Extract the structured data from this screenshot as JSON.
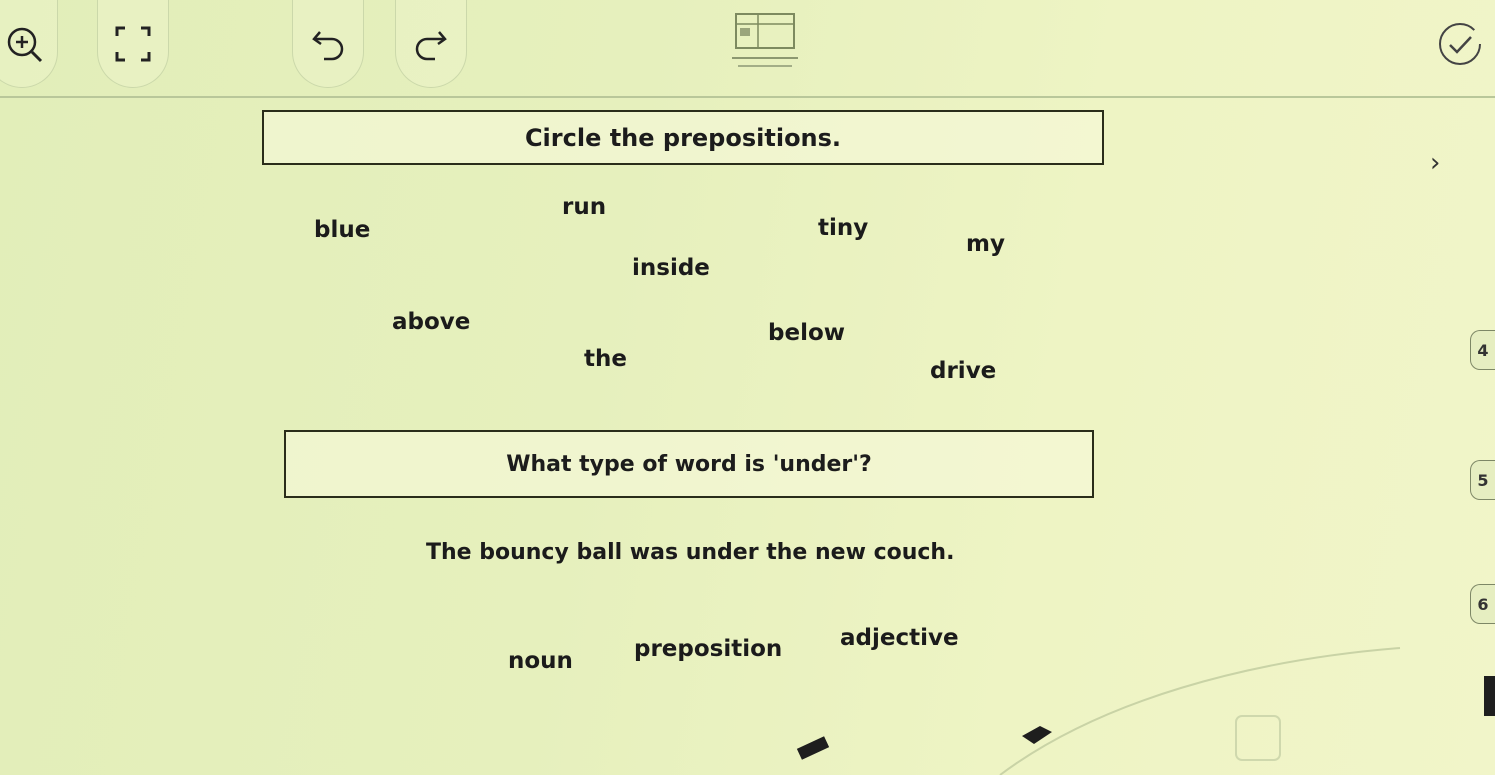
{
  "toolbar": {
    "zoom": "zoom-in",
    "fullscreen": "fullscreen",
    "undo": "undo",
    "redo": "redo",
    "pages": "page-thumbnails",
    "check": "check-answer"
  },
  "question1": {
    "prompt": "Circle the prepositions.",
    "words": [
      "run",
      "blue",
      "tiny",
      "my",
      "inside",
      "above",
      "below",
      "the",
      "drive"
    ]
  },
  "question2": {
    "prompt": "What type of word is 'under'?",
    "sentence": "The bouncy ball was under the new couch.",
    "options": [
      "noun",
      "preposition",
      "adjective"
    ]
  },
  "side_panel": {
    "next": "›",
    "page_numbers": [
      "4",
      "5",
      "6"
    ]
  },
  "colors": {
    "background": "#e6f0bd",
    "text": "#1b1b1b",
    "border": "#2a2d1a"
  }
}
